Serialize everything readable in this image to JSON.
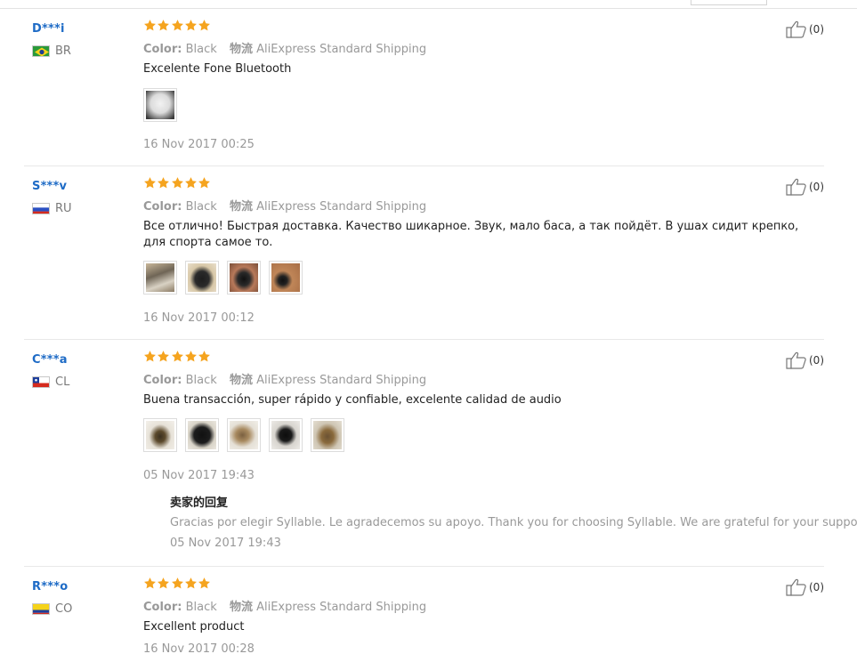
{
  "reviews": [
    {
      "user": "D***i",
      "country": "BR",
      "rating": 5,
      "color_label": "Color:",
      "color_value": "Black",
      "shipping_label": "物流",
      "shipping_value": "AliExpress Standard Shipping",
      "text": "Excelente Fone Bluetooth",
      "images": [
        "photo-white-bag"
      ],
      "date": "16 Nov 2017 00:25",
      "helpful": "(0)"
    },
    {
      "user": "S***v",
      "country": "RU",
      "rating": 5,
      "color_label": "Color:",
      "color_value": "Black",
      "shipping_label": "物流",
      "shipping_value": "AliExpress Standard Shipping",
      "text": "Все отлично! Быстрая доставка. Качество шикарное. Звук, мало баса, а так пойдёт. В ушах сидит крепко, для спорта самое то.",
      "images": [
        "photo-case",
        "photo-case-closed",
        "photo-hand",
        "photo-ear"
      ],
      "date": "16 Nov 2017 00:12",
      "helpful": "(0)"
    },
    {
      "user": "C***a",
      "country": "CL",
      "rating": 5,
      "color_label": "Color:",
      "color_value": "Black",
      "shipping_label": "物流",
      "shipping_value": "AliExpress Standard Shipping",
      "text": "Buena transacción, super rápido y confiable, excelente calidad de audio",
      "images": [
        "photo-bag",
        "photo-case-open",
        "photo-box",
        "photo-buds",
        "photo-case-gold"
      ],
      "date": "05 Nov 2017 19:43",
      "helpful": "(0)",
      "seller_reply": {
        "title": "卖家的回复",
        "text": "Gracias por elegir Syllable. Le agradecemos su apoyo. Thank you for choosing Syllable. We are grateful for your support.",
        "date": "05 Nov 2017 19:43"
      }
    },
    {
      "user": "R***o",
      "country": "CO",
      "rating": 5,
      "color_label": "Color:",
      "color_value": "Black",
      "shipping_label": "物流",
      "shipping_value": "AliExpress Standard Shipping",
      "text": "Excellent product",
      "images": [],
      "date": "16 Nov 2017 00:28",
      "helpful": "(0)"
    }
  ],
  "colors": {
    "star": "#f5a41f",
    "username": "#1e6bc6",
    "muted": "#999999"
  }
}
